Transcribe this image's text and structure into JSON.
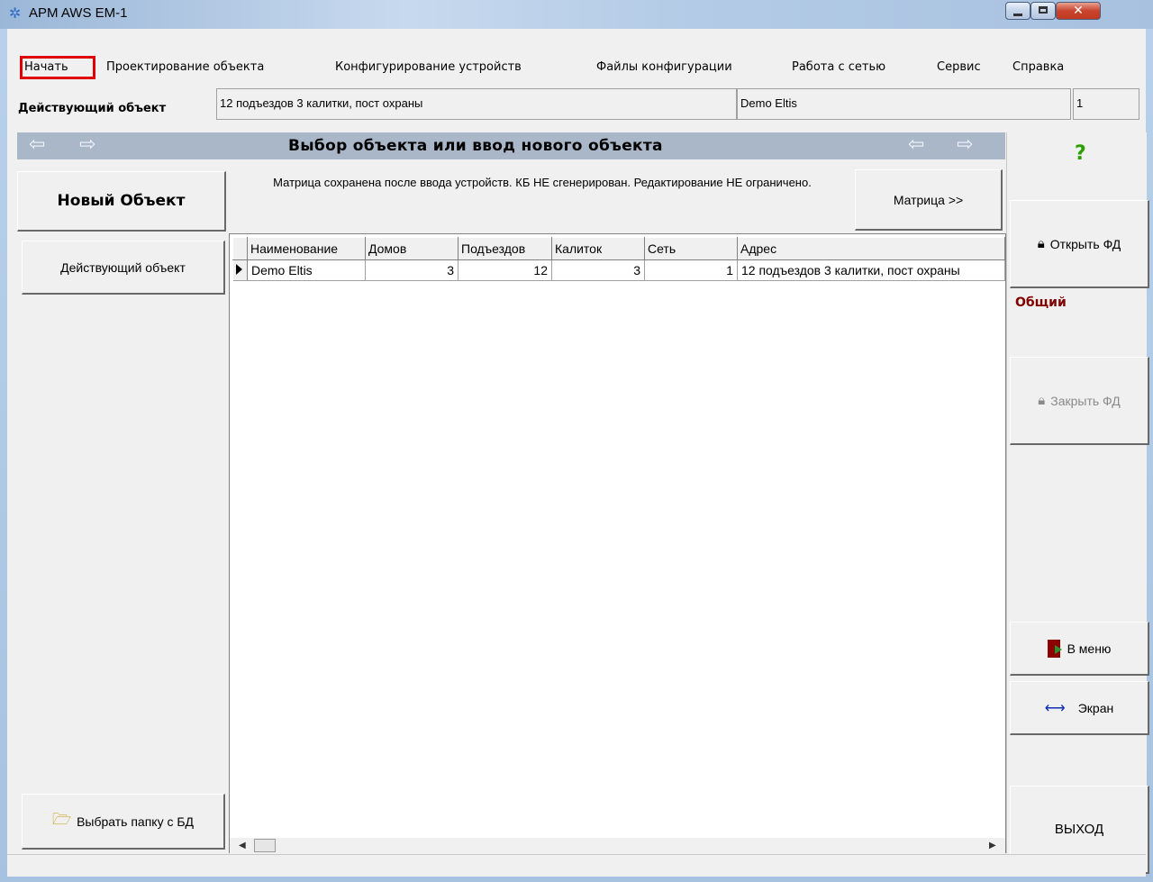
{
  "window": {
    "title": "APM AWS EM-1",
    "icon": "app-icon"
  },
  "menu": {
    "items": [
      "Начать",
      "Проектирование объекта",
      "Конфигурирование устройств",
      "Файлы конфигурации",
      "Работа с сетью",
      "Сервис",
      "Справка"
    ],
    "highlighted_item": "Начать"
  },
  "active_object": {
    "label": "Действующий объект",
    "description": "12 подъездов 3 калитки, пост охраны",
    "name": "Demo Eltis",
    "number": "1"
  },
  "nav": {
    "title": "Выбор объекта или ввод нового объекта",
    "back_icon": "arrow-left-icon",
    "forward_icon": "arrow-right-icon"
  },
  "new_object_button": "Новый Объект",
  "notice": "Матрица сохранена после ввода устройств. КБ НЕ сгенерирован. Редактирование НЕ ограничено.",
  "matrix_button": "Матрица >>",
  "left": {
    "active_object_button": "Действующий объект",
    "select_folder_button": "Выбрать папку с БД"
  },
  "table": {
    "columns": [
      "Наименование",
      "Домов",
      "Подъездов",
      "Калиток",
      "Сеть",
      "Адрес"
    ],
    "rows": [
      [
        "Demo Eltis",
        "3",
        "12",
        "3",
        "1",
        "12 подъездов 3 калитки, пост охраны"
      ]
    ]
  },
  "right": {
    "help": "?",
    "open_fd": "Открыть ФД",
    "general": "Общий",
    "close_fd": "Закрыть ФД",
    "to_menu": "В меню",
    "screen": "Экран",
    "exit": "ВЫХОД"
  },
  "colors": {
    "highlight": "#e10000",
    "help_icon": "#2aa000",
    "general_text": "#800000",
    "header_bg": "#a9b7c8"
  }
}
